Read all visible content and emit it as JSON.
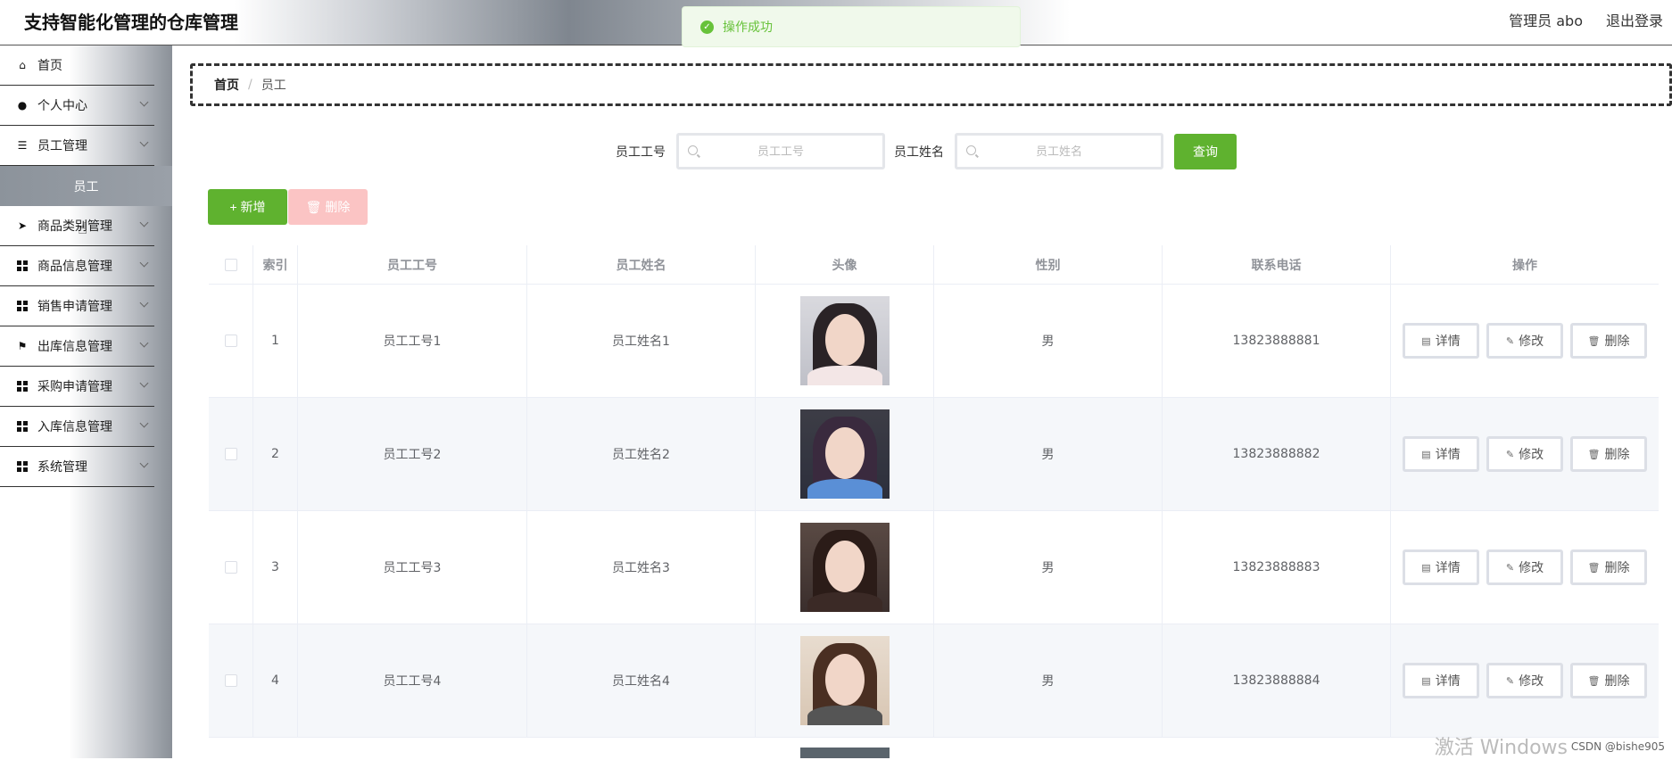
{
  "header": {
    "title": "支持智能化管理的仓库管理",
    "user_label": "管理员 abo",
    "logout_label": "退出登录"
  },
  "toast": {
    "message": "操作成功",
    "color": "#67c23a"
  },
  "sidebar": {
    "items": [
      {
        "label": "首页",
        "icon": "home-icon"
      },
      {
        "label": "个人中心",
        "icon": "user-icon"
      },
      {
        "label": "员工管理",
        "icon": "list-icon"
      },
      {
        "label": "商品类别管理",
        "icon": "paper-plane-icon"
      },
      {
        "label": "商品信息管理",
        "icon": "grid-icon"
      },
      {
        "label": "销售申请管理",
        "icon": "grid-icon"
      },
      {
        "label": "出库信息管理",
        "icon": "flag-icon"
      },
      {
        "label": "采购申请管理",
        "icon": "grid-icon"
      },
      {
        "label": "入库信息管理",
        "icon": "grid-icon"
      },
      {
        "label": "系统管理",
        "icon": "grid-icon"
      }
    ],
    "submenu_active": "员工"
  },
  "breadcrumb": {
    "home": "首页",
    "separator": "/",
    "current": "员工"
  },
  "search": {
    "no_label": "员工工号",
    "no_placeholder": "员工工号",
    "name_label": "员工姓名",
    "name_placeholder": "员工姓名",
    "query_label": "查询"
  },
  "actions": {
    "add_label": "+ 新增",
    "delete_label": "🗑 删除"
  },
  "table": {
    "headers": [
      "索引",
      "员工工号",
      "员工姓名",
      "头像",
      "性别",
      "联系电话",
      "操作"
    ],
    "rows": [
      {
        "index": "1",
        "no": "员工工号1",
        "name": "员工姓名1",
        "sex": "男",
        "tel": "13823888881"
      },
      {
        "index": "2",
        "no": "员工工号2",
        "name": "员工姓名2",
        "sex": "男",
        "tel": "13823888882"
      },
      {
        "index": "3",
        "no": "员工工号3",
        "name": "员工姓名3",
        "sex": "男",
        "tel": "13823888883"
      },
      {
        "index": "4",
        "no": "员工工号4",
        "name": "员工姓名4",
        "sex": "男",
        "tel": "13823888884"
      }
    ],
    "op_detail": "详情",
    "op_edit": "修改",
    "op_delete": "删除"
  },
  "watermark": "激活 Windows",
  "csdn": "CSDN @bishe905",
  "colors": {
    "primary_green": "#5fb22f",
    "danger_light": "#fbc4c4",
    "stripe": "#f5f7fa"
  }
}
